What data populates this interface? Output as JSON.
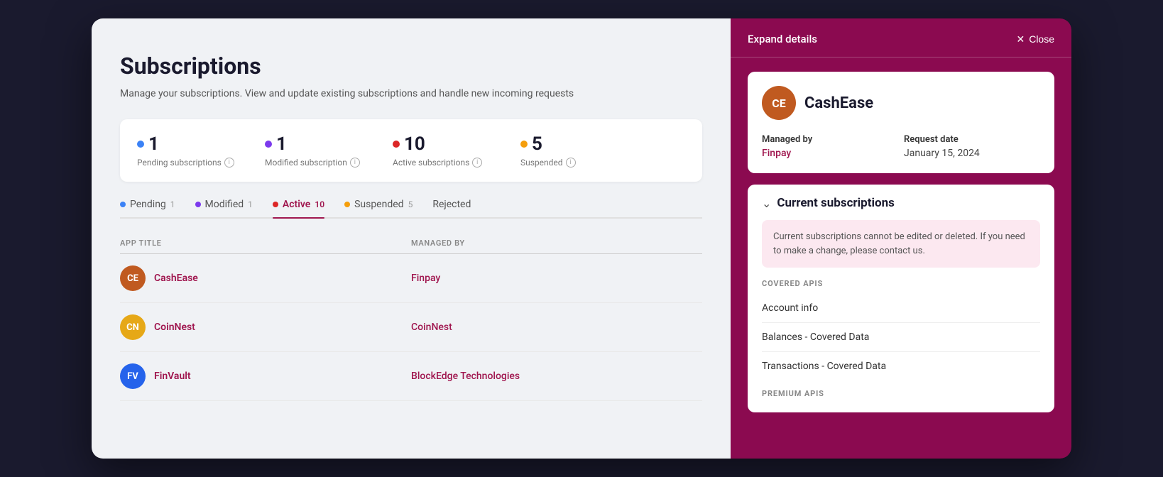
{
  "page": {
    "title": "Subscriptions",
    "subtitle": "Manage your subscriptions. View and update existing subscriptions and handle new incoming requests"
  },
  "stats": [
    {
      "number": "1",
      "label": "Pending subscriptions",
      "dot_color": "#3b82f6"
    },
    {
      "number": "1",
      "label": "Modified subscription",
      "dot_color": "#7c3aed"
    },
    {
      "number": "10",
      "label": "Active subscriptions",
      "dot_color": "#dc2626"
    },
    {
      "number": "5",
      "label": "Suspended",
      "dot_color": "#f59e0b"
    }
  ],
  "tabs": [
    {
      "label": "Pending",
      "count": "1",
      "dot_color": "#3b82f6",
      "active": false
    },
    {
      "label": "Modified",
      "count": "1",
      "dot_color": "#7c3aed",
      "active": false
    },
    {
      "label": "Active",
      "count": "10",
      "dot_color": "#dc2626",
      "active": true
    },
    {
      "label": "Suspended",
      "count": "5",
      "dot_color": "#f59e0b",
      "active": false
    },
    {
      "label": "Rejected",
      "count": "",
      "dot_color": null,
      "active": false
    }
  ],
  "table": {
    "columns": [
      "APP TITLE",
      "MANAGED BY"
    ],
    "rows": [
      {
        "app_initials": "CE",
        "app_name": "CashEase",
        "app_color": "#c05a20",
        "managed_by": "Finpay"
      },
      {
        "app_initials": "CN",
        "app_name": "CoinNest",
        "app_color": "#e6a817",
        "managed_by": "CoinNest"
      },
      {
        "app_initials": "FV",
        "app_name": "FinVault",
        "app_color": "#2563eb",
        "managed_by": "BlockEdge Technologies"
      }
    ]
  },
  "detail_panel": {
    "header": {
      "expand_details": "Expand details",
      "close_label": "Close"
    },
    "app": {
      "initials": "CE",
      "name": "CashEase",
      "avatar_color": "#c05a20",
      "managed_by_label": "Managed by",
      "managed_by_value": "Finpay",
      "request_date_label": "Request date",
      "request_date_value": "January 15, 2024"
    },
    "current_subscriptions": {
      "title": "Current subscriptions",
      "info_text": "Current subscriptions cannot be edited or deleted. If you need to make a change, please contact us.",
      "covered_apis_label": "COVERED APIS",
      "covered_apis": [
        "Account info",
        "Balances - Covered Data",
        "Transactions - Covered Data"
      ],
      "premium_apis_label": "PREMIUM APIS"
    }
  }
}
